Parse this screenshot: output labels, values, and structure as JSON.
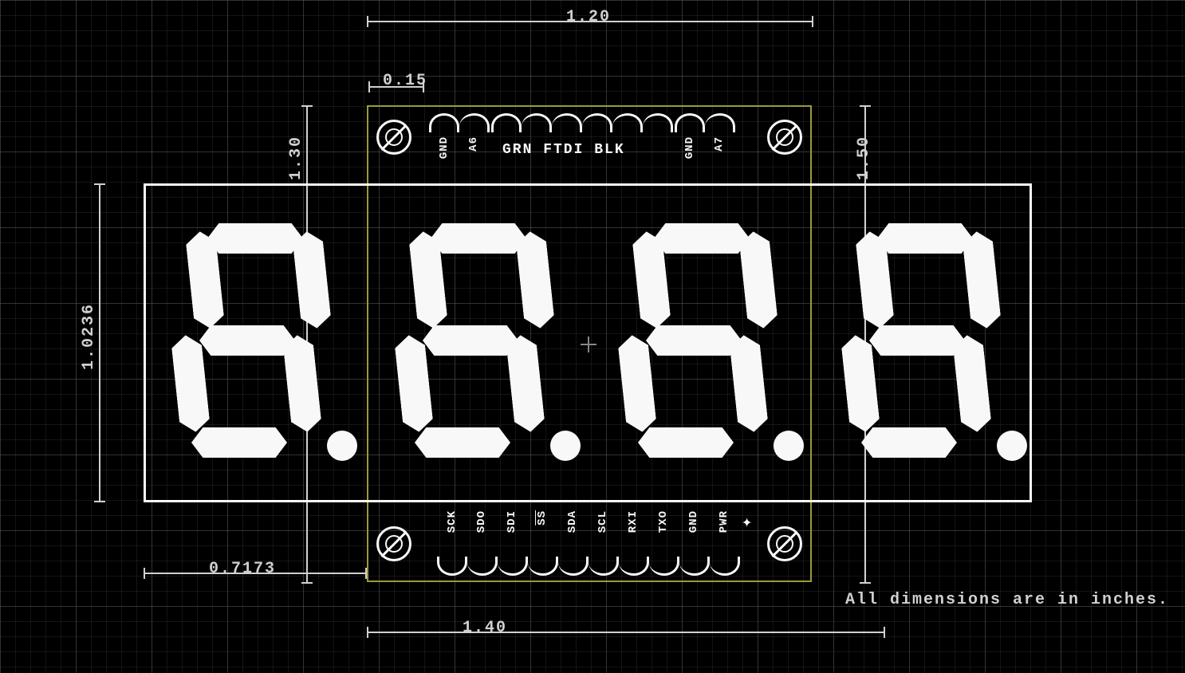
{
  "dimensions": {
    "top_width": "1.20",
    "edge_offset": "0.15",
    "bottom_width": "1.40",
    "left_inner_height": "1.30",
    "right_inner_height": "1.50",
    "display_height": "1.0236",
    "bottom_left_offset": "0.7173"
  },
  "silkscreen": {
    "top_center": "GRN FTDI BLK"
  },
  "top_pins": {
    "left": [
      "GND",
      "A6"
    ],
    "center_count": 6,
    "right": [
      "GND",
      "A7"
    ]
  },
  "bottom_pins": [
    "SCK",
    "SDO",
    "SDI",
    "SS",
    "SDA",
    "SCL",
    "RXI",
    "TXO",
    "GND",
    "PWR"
  ],
  "bottom_pins_overline": [
    false,
    false,
    false,
    true,
    false,
    false,
    false,
    false,
    false,
    false
  ],
  "note": "All dimensions are in inches.",
  "colors": {
    "outline_white": "#f8f8f8",
    "outline_olive": "#9a9a3a",
    "text_gray": "#d0d0d0"
  }
}
